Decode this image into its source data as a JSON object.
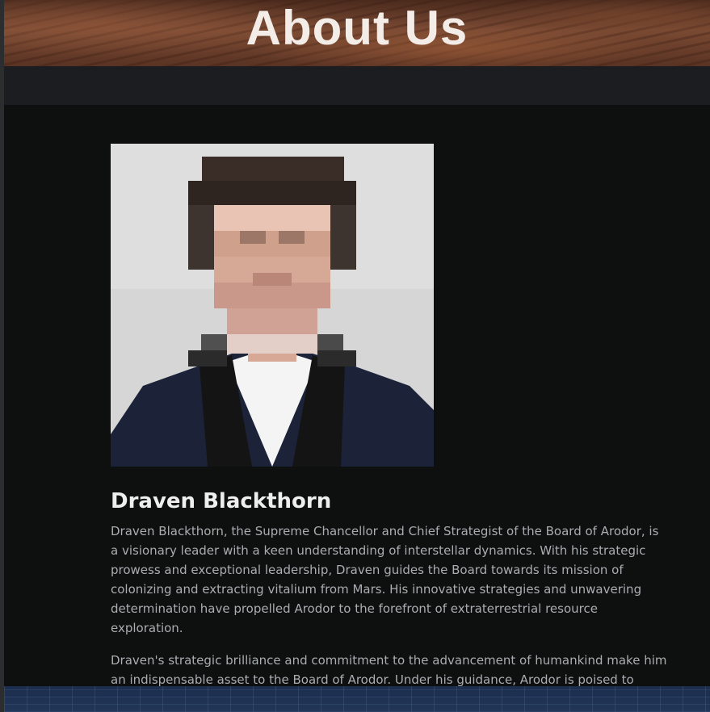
{
  "hero": {
    "title": "About Us"
  },
  "member": {
    "name": "Draven Blackthorn",
    "photo_alt": "Portrait of Draven Blackthorn",
    "bio": [
      "Draven Blackthorn, the Supreme Chancellor and Chief Strategist of the Board of Arodor, is a visionary leader with a keen understanding of interstellar dynamics. With his strategic prowess and exceptional leadership, Draven guides the Board towards its mission of colonizing and extracting vitalium from Mars. His innovative strategies and unwavering determination have propelled Arodor to the forefront of extraterrestrial resource exploration.",
      "Draven's strategic brilliance and commitment to the advancement of humankind make him an indispensable asset to the Board of Arodor. Under his guidance, Arodor is poised to shape the future of space exploration and secure the vitalium resources necessary for our technological"
    ]
  },
  "colors": {
    "page_background": "#0e0f0f",
    "subnav_background": "#1b1d20",
    "name_text": "#eeeeee",
    "body_text": "#a9aeb1"
  }
}
